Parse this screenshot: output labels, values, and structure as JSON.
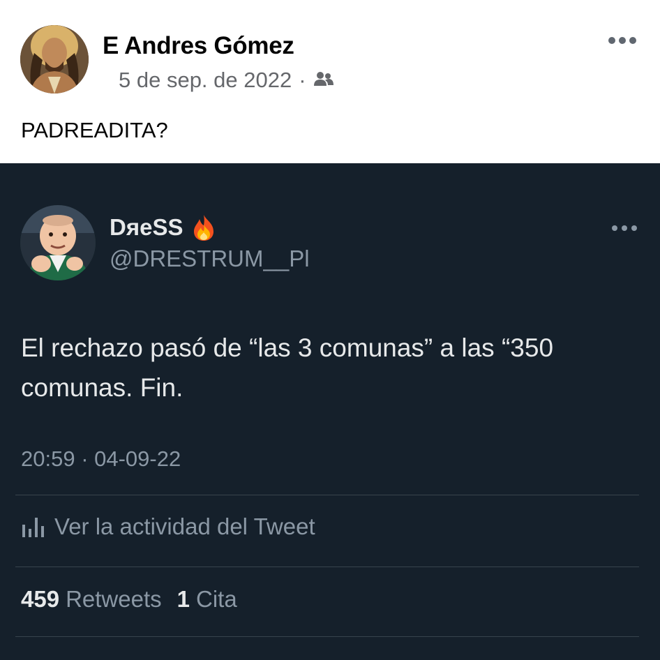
{
  "fb_post": {
    "author_name": "E Andres Gómez",
    "date": "5 de sep. de 2022",
    "separator": "·",
    "audience_icon": "friends-icon",
    "more_icon": "more-horizontal-icon",
    "text": "PADREADITA?"
  },
  "tweet": {
    "display_name": "DяeSS",
    "name_emoji_icon": "fire-emoji-icon",
    "handle": "@DRESTRUM__Pl",
    "more_icon": "more-horizontal-icon",
    "text": "El rechazo pasó de “las 3 comunas” a las “350 comunas. Fin.",
    "timestamp": "20:59 · 04-09-22",
    "activity_icon": "analytics-bars-icon",
    "activity_label": "Ver la actividad del Tweet",
    "retweets_count": "459",
    "retweets_label": "Retweets",
    "quotes_count": "1",
    "quotes_label": "Cita"
  },
  "colors": {
    "tweet_background": "#15202b",
    "tweet_primary_text": "#e7e9ea",
    "tweet_secondary_text": "#8b98a5",
    "fb_secondary_text": "#65676b"
  }
}
